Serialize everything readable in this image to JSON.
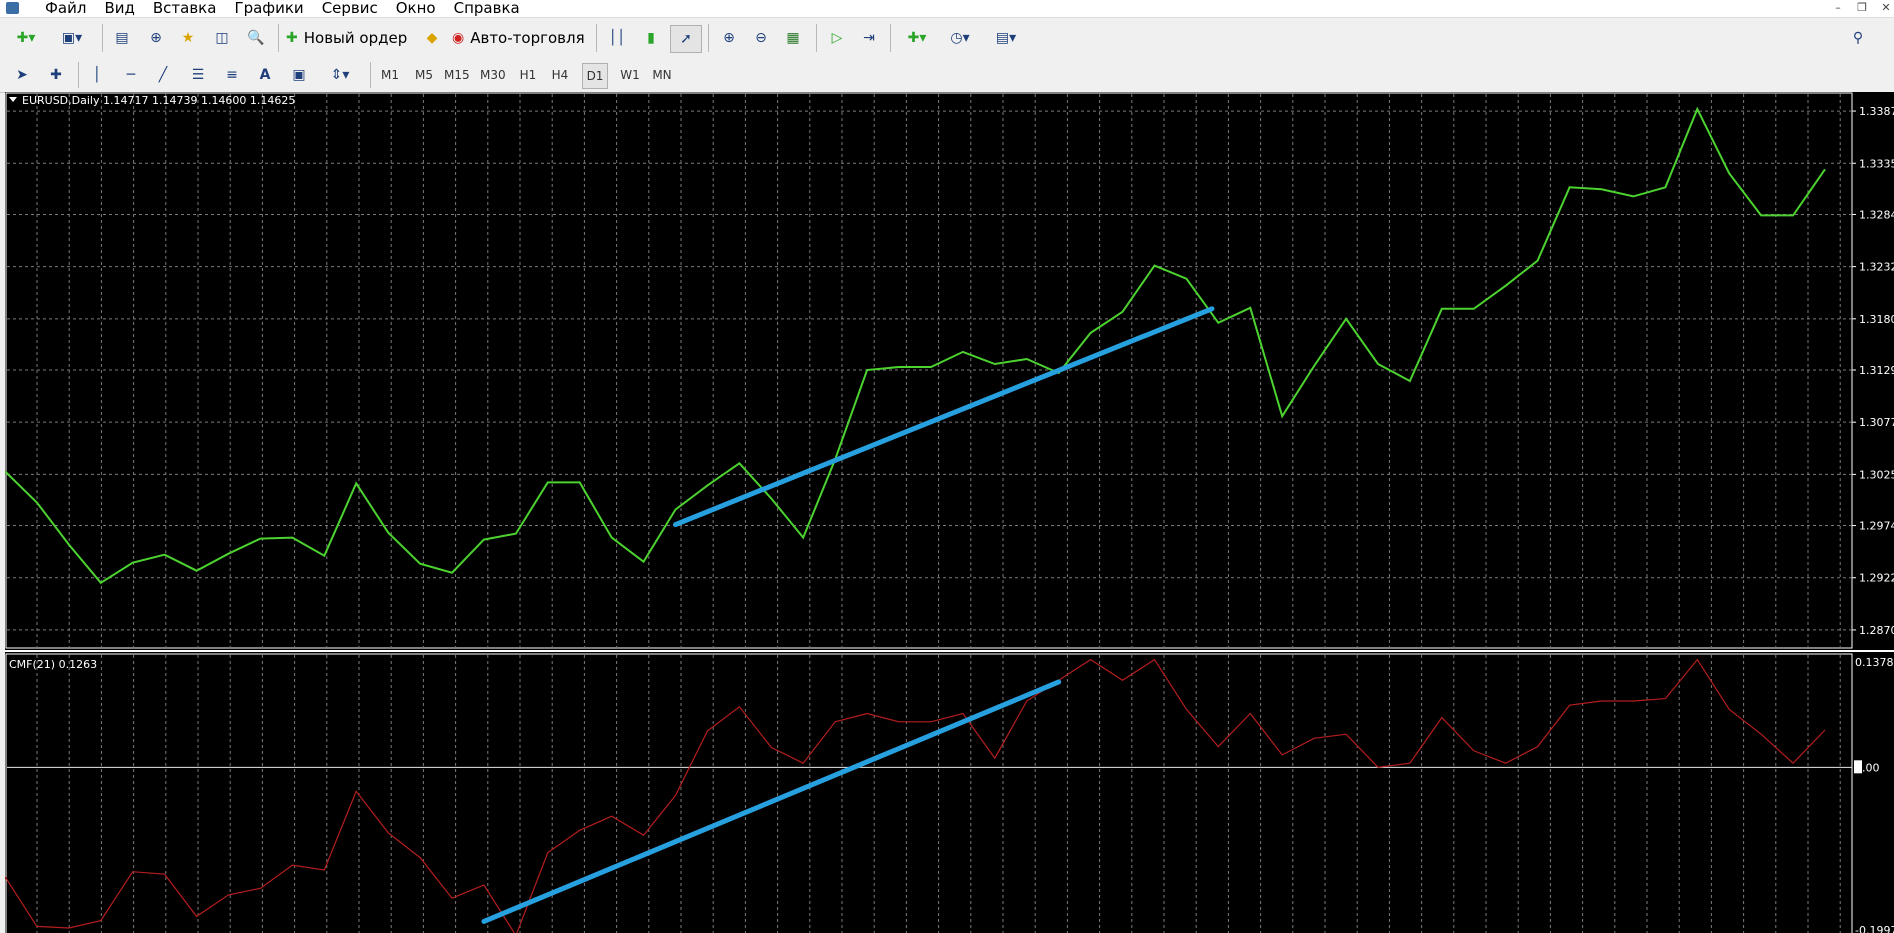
{
  "menu": {
    "items": [
      "Файл",
      "Вид",
      "Вставка",
      "Графики",
      "Сервис",
      "Окно",
      "Справка"
    ]
  },
  "toolbar": {
    "new_order_label": "Новый ордер",
    "auto_trading_label": "Авто-торговля"
  },
  "timeframes": [
    "M1",
    "M5",
    "M15",
    "M30",
    "H1",
    "H4",
    "D1",
    "W1",
    "MN"
  ],
  "active_timeframe": "D1",
  "main_chart": {
    "header": "EURUSD,Daily  1.14717 1.14739 1.14600 1.14625",
    "line_color": "#4cd330",
    "grid_color": "#7a7a7a",
    "price_labels": [
      "1.3387",
      "1.3335",
      "1.3284",
      "1.3232",
      "1.3180",
      "1.3129",
      "1.3077",
      "1.3025",
      "1.2974",
      "1.2922",
      "1.2870"
    ],
    "trendline_color": "#27a0e0"
  },
  "indicator": {
    "header": "CMF(21) 0.1263",
    "line_color": "#b51e1e",
    "zero_line_color": "#e8e8e8",
    "labels": [
      "0.1378",
      "0.00",
      "-0.1997"
    ]
  },
  "chart_data": [
    {
      "type": "line",
      "title": "EURUSD,Daily",
      "series": [
        {
          "name": "EURUSD",
          "values": [
            1.3028,
            1.2997,
            1.2955,
            1.2917,
            1.2937,
            1.2945,
            1.2929,
            1.2946,
            1.2961,
            1.2962,
            1.2944,
            1.3016,
            1.2967,
            1.2936,
            1.2927,
            1.296,
            1.2966,
            1.3017,
            1.3017,
            1.2962,
            1.2938,
            1.299,
            1.3014,
            1.3036,
            1.3001,
            1.2962,
            1.304,
            1.3129,
            1.3132,
            1.3132,
            1.3147,
            1.3135,
            1.314,
            1.3126,
            1.3166,
            1.3187,
            1.3233,
            1.322,
            1.3176,
            1.3191,
            1.3083,
            1.3133,
            1.318,
            1.3135,
            1.3118,
            1.319,
            1.319,
            1.3213,
            1.3238,
            1.3311,
            1.3309,
            1.3302,
            1.3311,
            1.3389,
            1.3325,
            1.3283,
            1.3283,
            1.3329
          ]
        }
      ],
      "ylim": [
        1.2851,
        1.3406
      ],
      "grid": true,
      "annotations": [
        {
          "type": "trendline",
          "color": "#27a0e0"
        }
      ]
    },
    {
      "type": "line",
      "title": "CMF(21)",
      "series": [
        {
          "name": "CMF(21)",
          "values": [
            -0.132,
            -0.192,
            -0.194,
            -0.185,
            -0.126,
            -0.129,
            -0.18,
            -0.154,
            -0.146,
            -0.118,
            -0.124,
            -0.029,
            -0.079,
            -0.109,
            -0.158,
            -0.142,
            -0.203,
            -0.103,
            -0.076,
            -0.059,
            -0.082,
            -0.034,
            0.044,
            0.073,
            0.024,
            0.005,
            0.055,
            0.065,
            0.055,
            0.055,
            0.065,
            0.011,
            0.08,
            0.105,
            0.13,
            0.105,
            0.13,
            0.07,
            0.025,
            0.065,
            0.015,
            0.035,
            0.04,
            0.0,
            0.005,
            0.06,
            0.02,
            0.005,
            0.025,
            0.075,
            0.08,
            0.08,
            0.083,
            0.13,
            0.07,
            0.04,
            0.005,
            0.045
          ]
        }
      ],
      "ylim": [
        -0.2,
        0.138
      ],
      "annotations": [
        {
          "type": "trendline",
          "color": "#27a0e0"
        }
      ]
    }
  ]
}
